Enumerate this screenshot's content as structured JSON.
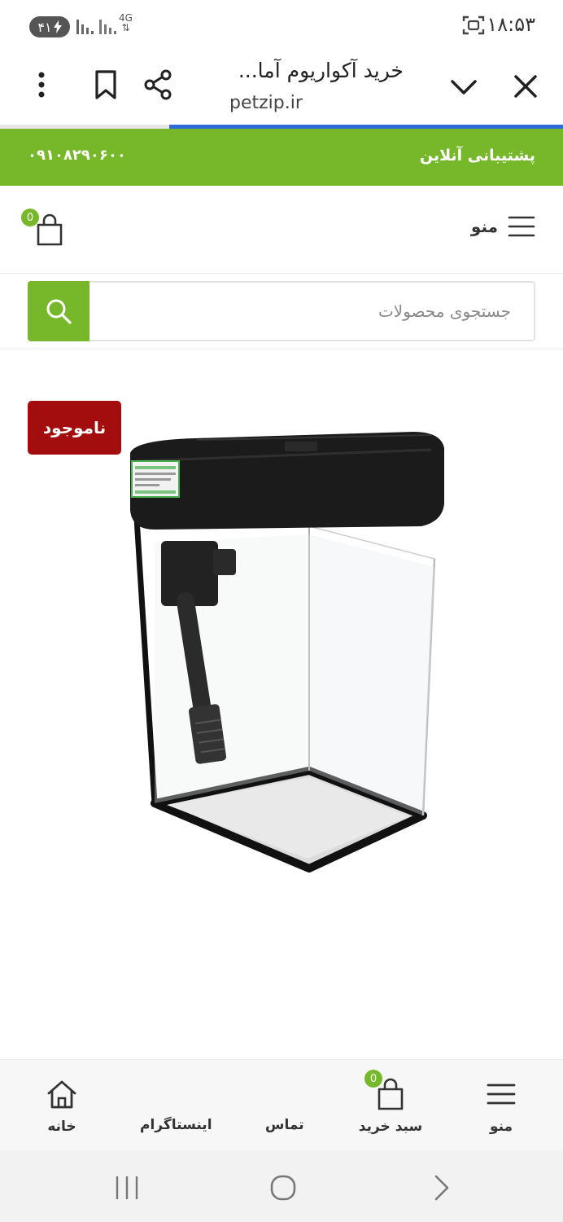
{
  "status_bar": {
    "time": "۱۸:۵۳",
    "battery": "۴۱",
    "network": "4G"
  },
  "browser": {
    "title": "خرید آکواریوم آما...",
    "url": "petzip.ir",
    "load_progress": 0.7,
    "icons": [
      "close-icon",
      "chevron-down-icon",
      "share-icon",
      "bookmark-icon",
      "more-vert-icon"
    ]
  },
  "banner": {
    "support_label": "پشتیبانی آنلاین",
    "phone": "۰۹۱۰۸۲۹۰۶۰۰",
    "color": "#76b82a"
  },
  "header": {
    "menu_label": "منو",
    "cart_count": "0"
  },
  "search": {
    "placeholder": "جستجوی محصولات",
    "value": ""
  },
  "product": {
    "stock_status": "ناموجود",
    "stock_color": "#a30d0d"
  },
  "bottom_nav": {
    "items": [
      {
        "label": "منو",
        "icon": "menu-icon"
      },
      {
        "label": "سبد خرید",
        "icon": "cart-icon",
        "badge": "0"
      },
      {
        "label": "تماس",
        "icon": ""
      },
      {
        "label": "اینستاگرام",
        "icon": ""
      },
      {
        "label": "خانه",
        "icon": "home-icon"
      }
    ]
  }
}
